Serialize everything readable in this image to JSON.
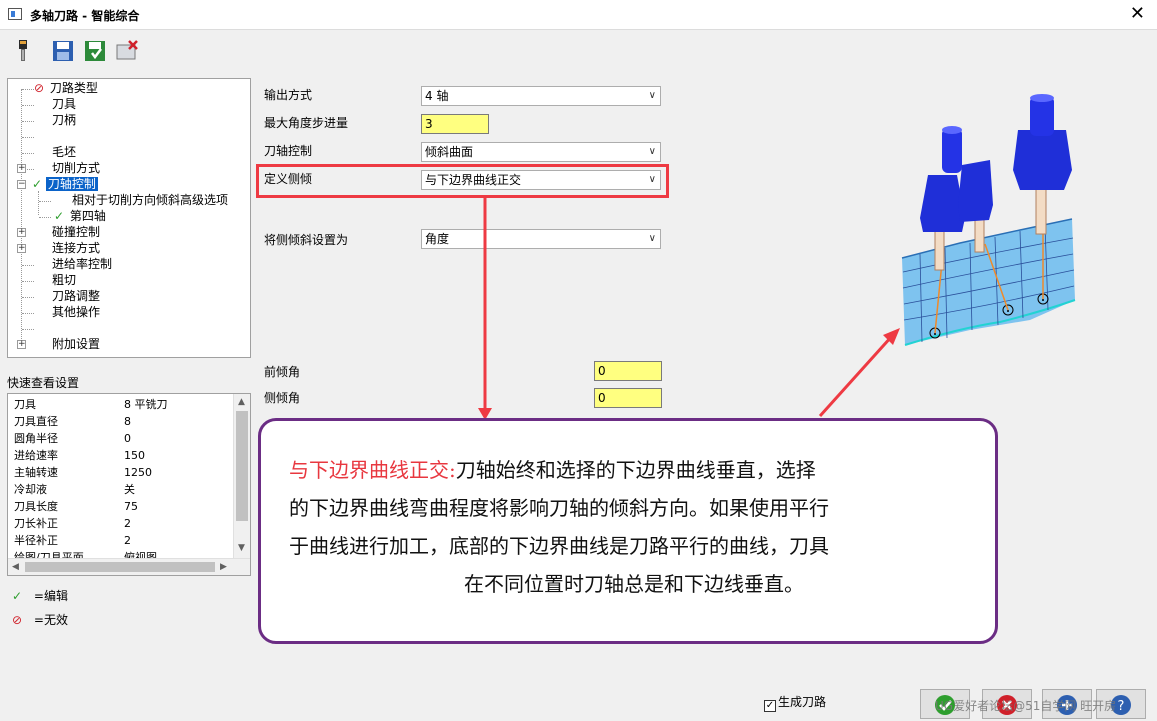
{
  "window": {
    "title": "多轴刀路 - 智能综合",
    "close_symbol": "✕"
  },
  "tree": {
    "items": [
      {
        "label": "刀路类型",
        "status": "invalid"
      },
      {
        "label": "刀具"
      },
      {
        "label": "刀柄"
      },
      {
        "label": ""
      },
      {
        "label": "毛坯"
      },
      {
        "label": "切削方式",
        "expandable": true
      },
      {
        "label": "刀轴控制",
        "expandable": true,
        "status": "edited",
        "selected": true
      },
      {
        "label": "相对于切削方向倾斜高级选项",
        "level": 2
      },
      {
        "label": "第四轴",
        "level": 2,
        "status": "edited"
      },
      {
        "label": "碰撞控制",
        "expandable": true
      },
      {
        "label": "连接方式",
        "expandable": true
      },
      {
        "label": "进给率控制"
      },
      {
        "label": "粗切"
      },
      {
        "label": "刀路调整"
      },
      {
        "label": "其他操作"
      },
      {
        "label": ""
      },
      {
        "label": "附加设置",
        "expandable": true
      }
    ]
  },
  "quick_view": {
    "label": "快速查看设置",
    "rows": [
      {
        "k": "刀具",
        "v": "8 平铣刀"
      },
      {
        "k": "刀具直径",
        "v": "8"
      },
      {
        "k": "圆角半径",
        "v": "0"
      },
      {
        "k": "进给速率",
        "v": "150"
      },
      {
        "k": "主轴转速",
        "v": "1250"
      },
      {
        "k": "冷却液",
        "v": "关"
      },
      {
        "k": "刀具长度",
        "v": "75"
      },
      {
        "k": "刀长补正",
        "v": "2"
      },
      {
        "k": "半径补正",
        "v": "2"
      },
      {
        "k": "绘图/刀具平面",
        "v": "俯视图"
      }
    ]
  },
  "legend": {
    "edited": "=编辑",
    "invalid": "=无效"
  },
  "form": {
    "output_mode": {
      "label": "输出方式",
      "value": "4 轴"
    },
    "max_angle_step": {
      "label": "最大角度步进量",
      "value": "3"
    },
    "axis_control": {
      "label": "刀轴控制",
      "value": "倾斜曲面"
    },
    "define_tilt": {
      "label": "定义侧倾",
      "value": "与下边界曲线正交"
    },
    "set_tilt_as": {
      "label": "将侧倾斜设置为",
      "value": "角度"
    },
    "lead_angle": {
      "label": "前倾角",
      "value": "0"
    },
    "side_tilt_angle": {
      "label": "侧倾角",
      "value": "0"
    }
  },
  "callout": {
    "highlight": "与下边界曲线正交:",
    "line1": "刀轴始终和选择的下边界曲线垂直，选择",
    "line2": "的下边界曲线弯曲程度将影响刀轴的倾斜方向。如果使用平行",
    "line3": "于曲线进行加工，底部的下边界曲线是刀路平行的曲线，刀具",
    "line4": "在不同位置时刀轴总是和下边线垂直。"
  },
  "footer": {
    "generate_label": "生成刀路",
    "generate_checked": true
  },
  "watermark": "UG爱好者论坛@51自学网 旺开房",
  "colors": {
    "highlight_red": "#ee3a43",
    "callout_border": "#6b2d84",
    "selection_blue": "#0b63c9",
    "input_yellow": "#ffff80"
  }
}
